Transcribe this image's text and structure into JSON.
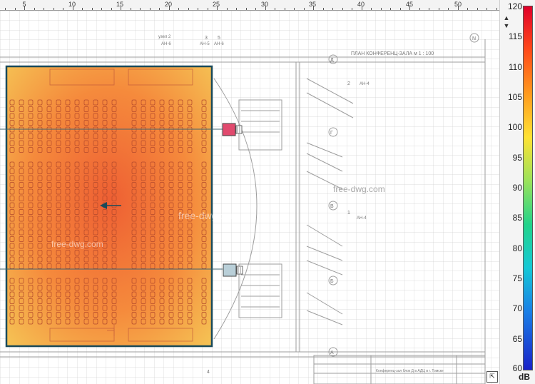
{
  "ruler": {
    "labels": [
      "5",
      "10",
      "15",
      "20",
      "25",
      "30",
      "35",
      "40",
      "45",
      "50"
    ]
  },
  "plan": {
    "title": "ПЛАН КОНФЕРЕНЦ-ЗАЛА м 1 : 100",
    "stamp_text": "Конференц-зал блок Д в АДЦ в г. Томске",
    "section_marks": [
      "2",
      "АН-4",
      "1",
      "АН-4",
      "3",
      "АН-5",
      "5",
      "АН-6",
      "узел 2",
      "АН-6",
      "4",
      "N"
    ],
    "axis_marks": [
      "Д",
      "Г",
      "В",
      "Б",
      "А"
    ],
    "watermarks": [
      "free-dwg.com",
      "free-dwg.com",
      "free-dwg.com"
    ]
  },
  "scale": {
    "labels": [
      "120",
      "115",
      "110",
      "105",
      "100",
      "95",
      "90",
      "85",
      "80",
      "75",
      "70",
      "65",
      "60"
    ],
    "unit": "dB",
    "min": 60,
    "max": 120
  },
  "heatmap": {
    "colors": {
      "edge": "#f5c455",
      "mid": "#f58a3c",
      "hot": "#ee5f33",
      "outline": "#1a4a5a"
    }
  },
  "speakers": [
    {
      "color": "#e14a6e"
    },
    {
      "color": "#b9cfd8"
    }
  ],
  "resize_glyph": "⇱"
}
